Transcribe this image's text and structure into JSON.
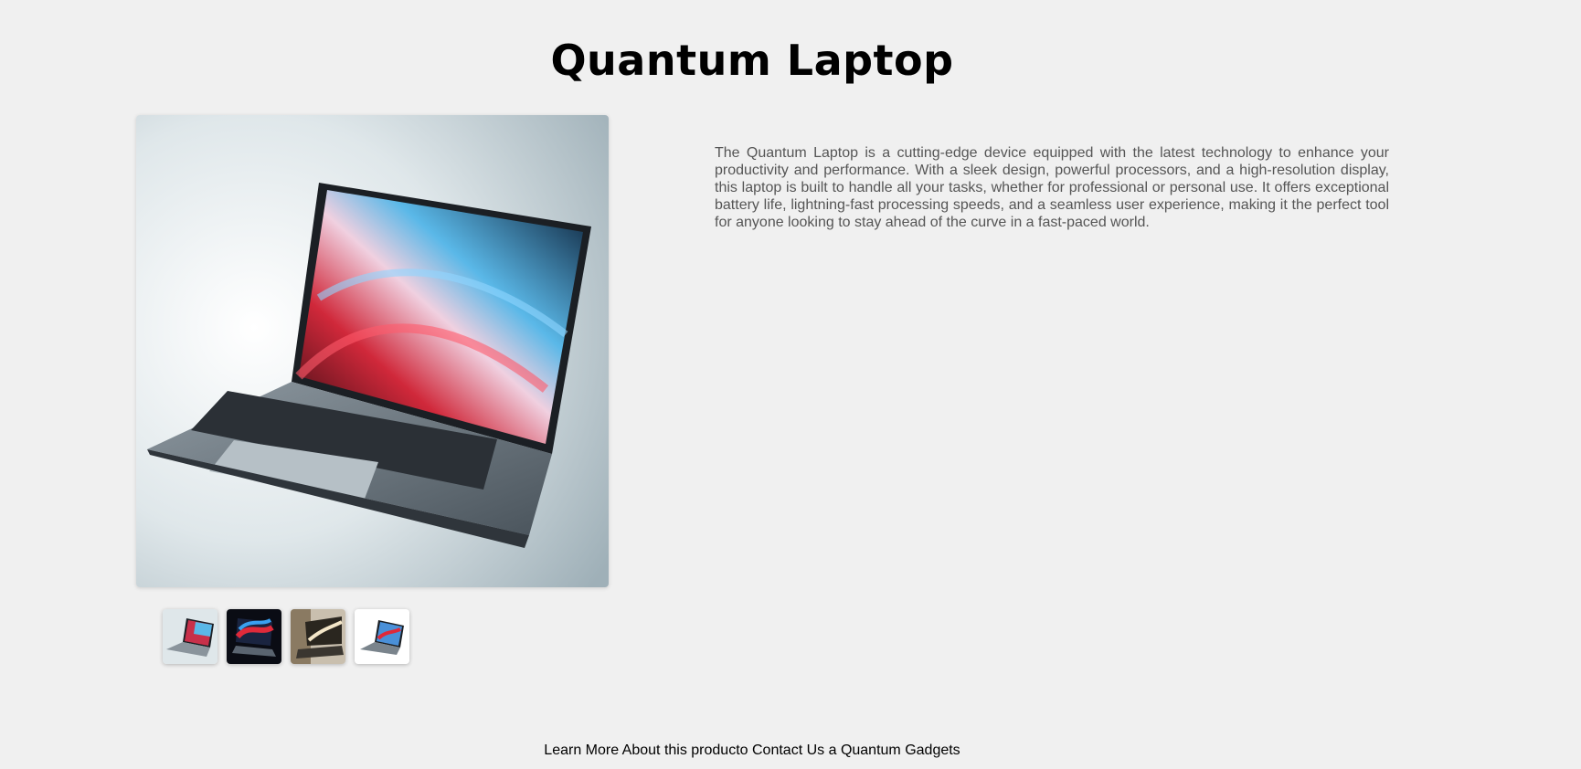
{
  "product": {
    "title": "Quantum Laptop",
    "description": "The Quantum Laptop is a cutting-edge device equipped with the latest technology to enhance your productivity and performance. With a sleek design, powerful processors, and a high-resolution display, this laptop is built to handle all your tasks, whether for professional or personal use. It offers exceptional battery life, lightning-fast processing speeds, and a seamless user experience, making it the perfect tool for anyone looking to stay ahead of the curve in a fast-paced world."
  },
  "footer": {
    "learn_more": "Learn More About this producto",
    "contact": "Contact Us",
    "brand": "a Quantum Gadgets"
  },
  "colors": {
    "background": "#f0f0f0",
    "text": "#000000",
    "description_text": "#555555"
  }
}
